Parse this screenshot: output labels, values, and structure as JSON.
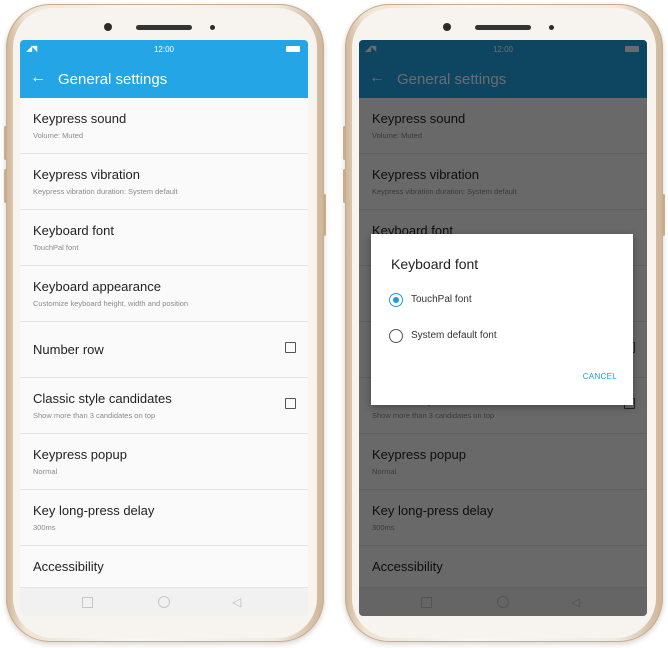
{
  "status_bar": {
    "time": "12:00",
    "signal": "◢◥",
    "battery": ""
  },
  "header": {
    "back_icon": "arrow-left-icon",
    "back_glyph": "←",
    "title": "General settings"
  },
  "settings": [
    {
      "title": "Keypress sound",
      "subtitle": "Volume: Muted",
      "checkbox": false
    },
    {
      "title": "Keypress vibration",
      "subtitle": "Keypress vibration duration: System default",
      "checkbox": false
    },
    {
      "title": "Keyboard font",
      "subtitle": "TouchPal font",
      "checkbox": false
    },
    {
      "title": "Keyboard appearance",
      "subtitle": "Customize keyboard height, width and position",
      "checkbox": false
    },
    {
      "title": "Number row",
      "subtitle": "",
      "checkbox": true,
      "checked": false
    },
    {
      "title": "Classic style candidates",
      "subtitle": "Show more than 3 candidates on top",
      "checkbox": true,
      "checked": false
    },
    {
      "title": "Keypress popup",
      "subtitle": "Normal",
      "checkbox": false
    },
    {
      "title": "Key long-press delay",
      "subtitle": "300ms",
      "checkbox": false
    },
    {
      "title": "Accessibility",
      "subtitle": "",
      "checkbox": false
    }
  ],
  "nav_bar": {
    "recents_icon": "square-icon",
    "home_icon": "circle-icon",
    "back_icon": "triangle-back-icon",
    "back_glyph": "◁"
  },
  "dialog": {
    "title": "Keyboard font",
    "options": [
      {
        "label": "TouchPal font",
        "selected": true
      },
      {
        "label": "System default font",
        "selected": false
      }
    ],
    "cancel_label": "CANCEL"
  },
  "colors": {
    "accent": "#23a5e6",
    "radio_selected": "#1e9ae0",
    "scrim": "rgba(0,0,0,0.58)",
    "phone_frame": "#efe3d3"
  }
}
